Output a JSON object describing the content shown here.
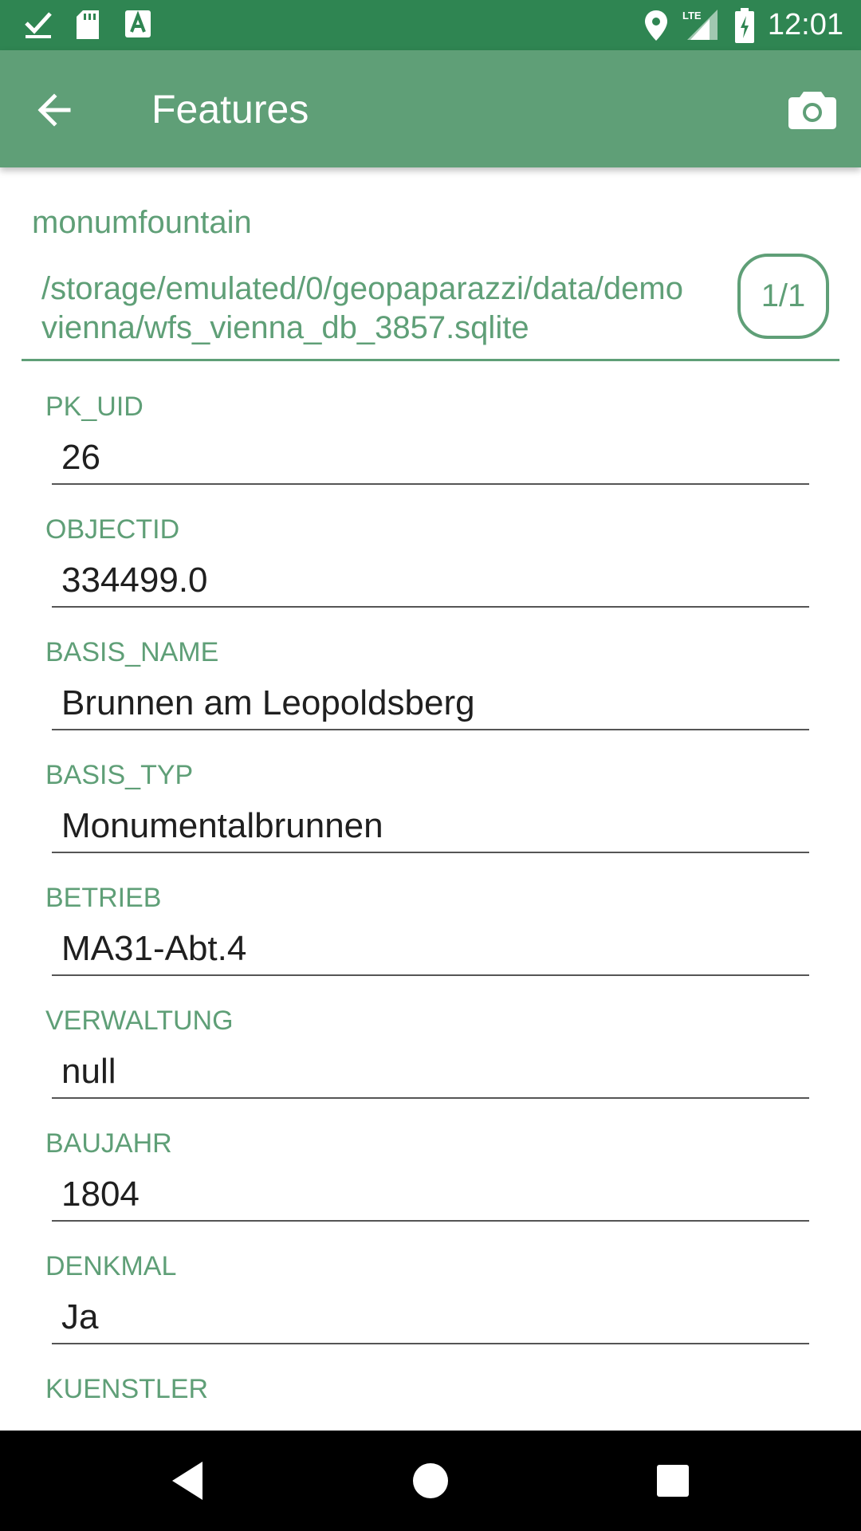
{
  "status_bar": {
    "time": "12:01",
    "icons": [
      "check-icon",
      "sd-card-icon",
      "app-a-icon",
      "location-icon",
      "lte-signal-icon",
      "battery-charging-icon"
    ],
    "network": "LTE"
  },
  "app_bar": {
    "title": "Features",
    "back_icon": "arrow-back-icon",
    "action_icon": "camera-icon"
  },
  "feature_header": {
    "layer_name": "monumfountain",
    "db_path_line1": "/storage/emulated/0/geopaparazzi/data/demo",
    "db_path_line2": "vienna/wfs_vienna_db_3857.sqlite",
    "counter": "1/1"
  },
  "fields": [
    {
      "label": "PK_UID",
      "value": "26"
    },
    {
      "label": "OBJECTID",
      "value": "334499.0"
    },
    {
      "label": "BASIS_NAME",
      "value": "Brunnen am Leopoldsberg"
    },
    {
      "label": "BASIS_TYP",
      "value": "Monumentalbrunnen"
    },
    {
      "label": "BETRIEB",
      "value": "MA31-Abt.4"
    },
    {
      "label": "VERWALTUNG",
      "value": "null"
    },
    {
      "label": "BAUJAHR",
      "value": "1804"
    },
    {
      "label": "DENKMAL",
      "value": "Ja"
    },
    {
      "label": "KUENSTLER",
      "value": ""
    }
  ],
  "nav_bar": {
    "back_icon": "nav-back-icon",
    "home_icon": "nav-home-icon",
    "recents_icon": "nav-recents-icon"
  },
  "colors": {
    "status_bar": "#2f8552",
    "app_bar": "#5f9f77",
    "accent": "#5f9f77",
    "value_text": "#1f1f1f"
  }
}
